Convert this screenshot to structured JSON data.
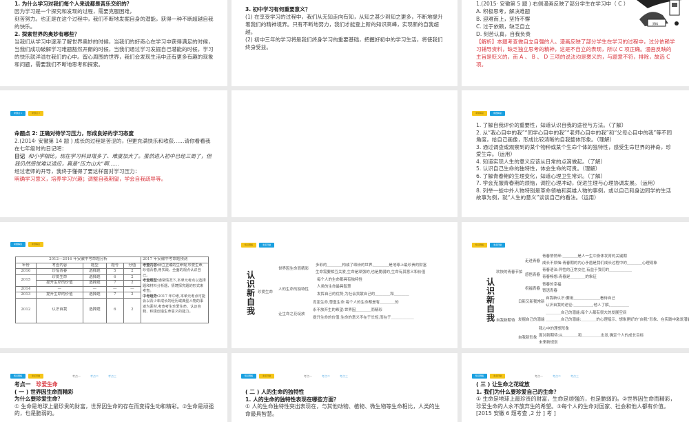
{
  "slides": {
    "s1": {
      "q1": "1. 为什么学习对我们每个人来说都是苦乐交织的？",
      "a1": "因为学习是一个探究和发现的过程，需要克服困难，",
      "a1b": "刻苦努力。也正是在这个过程中，我们不断地发掘自身的潜能，获得一种不断超越自我的快乐。",
      "q2": "2. 探索世界的奥妙有哪些？",
      "a2": "当我们从学习中逐渐了解世界奥妙的时候，当我们的好奇心在学习中获得满足的时候，当我们成功破解学习难题豁然开朗的时候，当我们通过学习发掘自己潜能的时候，学习的快乐就洋溢在我们的心中。留心周围的世界，我们会发现生活中还有更多有趣的现象和问题，需要我们不断地思考和探索。"
    },
    "s2": {
      "q3": "3. 初中学习有何重要意义？",
      "a1": "(1) 在享受学习的过程中，我们从无知走向有知，从知之甚少到知之更多，不断地提升着我们的精神境界。只有不断地努力，我们才能登上新的知识高峰，实现新的自我超越。",
      "a2": "(2) 初中三年的学习将是我们终身学习的重要基础，把握好初中的学习生活，将使我们终身受益。"
    },
    "s3": {
      "q": "1.(2015· 安徽第 5 题 ) 右侧漫画反映了部分学生在学习中（  C  ）",
      "opts": [
        "A. 积极思考，解决难题",
        "B. 迎难而上，坚持不懈",
        "C. 过于依赖，缺乏自立",
        "D. 刻苦认真，自我负责"
      ],
      "analysis": "【解析】本题考查做自立自强的人。漫画反映了部分学生在学习的过程中，过分依赖学习辅导资料，缺乏独立思考的精神，这是不自立的表现，所以 C 项正确。漫画反映的主旨是贬义的，而 A 、 B 、 D 三项的说法均是褒义的，与题意不符，排除，故选 C 项。",
      "cartoon_label": "资料"
    },
    "s4": {
      "badges": [
        "命题点 1",
        "命题点 2"
      ],
      "title": "命题点 2: 正确对待学习压力，形成良好的学习态度",
      "q": "2.(2014· 安徽第 14 题 ) 成长的过程是苦涩的，但更充满快乐和收获……请你看看我在七年级时的日记吧：",
      "diary_label": "日记",
      "diary": "和小学相比，现在学习科目增多了、难度加大了。虽然进入初中已经三周了，但我仍然感觉难以适应，真是“压力山大”啊……",
      "lead": "经过老师的开导，我终于懂得了要这样面对学习压力：",
      "answer": "明确学习意义，培养学习兴趣；调整自我期望，学会自我疏导等。"
    },
    "s6": {
      "badges": [
        "考纲解读",
        "命题解读"
      ],
      "items": [
        "1. 了解自我评价的重要性，知道认识自我的途径与方法。（了解）",
        "2. 从“我心目中的我”“同学心目中的我”“老师心目中的我”和“父母心目中的我”等不同角度，给自己画像，形成比较清晰的自我整体形象。（理解）",
        "3. 通过调查或观察到的某个物种或某个生命个体的独特性，感受生命世界的神奇，珍爱生命。（运用）",
        "4. 知道实现人生的意义应该从日常的点滴做起。（了解）",
        "5. 认识自己生命的独特性，体会生命的可贵。（理解）",
        "6. 了解青春期的生理变化，知道心理卫生常识。（了解）",
        "7. 学会克服青春期的烦恼，调控心理冲动，促进生理与心理协调发展。（运用）",
        "8. 列举一些中外人物特别是革命领袖和英雄人物的事例，或以自己和身边同学的生活故事为例，就“人生的意义”谈谈自己的看法。（运用）"
      ]
    },
    "s7": {
      "badges": [
        "考纲解读",
        "命题解读"
      ],
      "table_title": "2012—2016 年安徽中考命题分析",
      "pred_title": "2017 年安徽中考命题预测",
      "headers": [
        "年份",
        "考查内容",
        "题型",
        "题号",
        "分值"
      ],
      "rows": [
        [
          "2016",
          "珍惜青春",
          "选择题",
          "5",
          "2"
        ],
        [
          "2015",
          "珍爱生命",
          "选择题",
          "6",
          "2"
        ],
        [
          "",
          "提升生命的价值",
          "选择题",
          "7",
          "2"
        ],
        [
          "2014",
          "—",
          "—",
          "—",
          "—"
        ],
        [
          "2013",
          "提升生命的价值",
          "选择题",
          "7",
          "2"
        ],
        [
          "2012",
          "认识自我",
          "选择题",
          "6",
          "2"
        ]
      ],
      "pred": [
        {
          "k": "考查内容:",
          "v": "树立正确的生命观,珍爱生命,珍惜青春,用实践、全面的观点认识自己。"
        },
        {
          "k": "考查题型:",
          "v": "通常情况下,本单元考点以选择题和材料分析题、情境探究题的形式来考查。"
        },
        {
          "k": "中考趋势:",
          "v": "2017 年中考,本单元考点可能会以青少年成长的经历或典型人物的事迹为素材,考查考生珍爱生命、认识自我、积极创造生命意义的能力。"
        }
      ]
    },
    "s8": {
      "badges": [
        "知识网络",
        "考点扫描"
      ],
      "root": "认识新自我",
      "branch": "珍爱生命",
      "subs": [
        "世界因生命而精彩",
        "人的生命的独特性",
        "让生命之花绽放"
      ],
      "leaves": [
        "多彩的＿＿＿＿构成了缤纷的世界,＿＿＿＿是地球上最珍贵的财富",
        "生命需要相互关爱,生命是顽强的,也是脆弱的,生命有其意义和价值",
        "每个人的生命都具有独特性",
        "人类的生命最具智慧",
        "发挥自己的优势,为社会贡献自己的＿＿＿＿和＿＿＿＿",
        "肯定生命,尊重生命:每个人的生命都是有＿＿＿＿的",
        "永不放弃生的希望:世界因＿＿＿＿而精彩",
        "提升生命的价值:生命的意义不在于长短,而在于＿＿＿＿＿＿"
      ]
    },
    "s9": {
      "badges": [
        "知识网络",
        "考点扫描"
      ],
      "root": "认识新自我",
      "branches": [
        "欢快的青春节拍",
        "自我新期待"
      ],
      "subs": [
        "走进青春",
        "感悟青春",
        "祝福青春",
        "日新又新我常新",
        "发掘自己的潜能",
        "自我新形象"
      ],
      "leaves": [
        "青春悄悄来:＿＿＿＿是人一生中身体发育的关键期",
        "成长不烦恼:青春期的内心矛盾是我们成长过程中的＿＿＿＿心理现象",
        "青春语法:异性的正常交往,有益于我们的＿＿＿＿＿＿",
        "青春畅想:青春是＿＿＿＿的象征",
        "青春的幸福",
        "寄语青春",
        "自我新认识:要用＿＿＿＿＿＿＿看待自己",
        "认识自我的途径:＿＿＿＿＿,他人了解,＿＿＿＿＿",
        "＿＿＿＿自己的潜能:每个人都有很大的发展空间",
        "＿＿＿＿自己的潜能:＿＿＿＿的心理暗示、想象更好的“自我”形象、在实践中激发潜能",
        "我心中的理想形象",
        "面对新期待:从＿＿＿＿和＿＿＿＿＿出发,确定个人的成长目标",
        "未来新规划"
      ]
    },
    "s10": {
      "badges": [
        "知识网络",
        "考点扫描"
      ],
      "tabs": [
        "考点一",
        "考点二",
        "考点三"
      ],
      "h1": "考点一",
      "h1red": "珍爱生命",
      "h2": "( 一 ) 世界因生命而精彩",
      "h3": "为什么要珍爱生命？",
      "p": "① 生命是地球上最珍贵的财富，世界因生命的存在而变得生动和精彩。②生命是顽强的，也是脆弱的。"
    },
    "s11": {
      "badges": [
        "知识网络",
        "考点扫描"
      ],
      "tabs": [
        "考点一",
        "考点二",
        "考点三"
      ],
      "h2": "( 二 ) 人的生命的独特性",
      "h3": "1. 人的生命的独特性表现在哪些方面？",
      "p": "① 人的生命独特性突出表现在，与其他动物、植物、微生物等生命相比，人类的生命最具智慧。"
    },
    "s12": {
      "badges": [
        "知识网络",
        "考点扫描"
      ],
      "tabs": [
        "考点一",
        "考点二",
        "考点三"
      ],
      "h2": "( 三 ) 让生命之花绽放",
      "h3": "1. 我们为什么要珍爱自己的生命？",
      "p": "① 生命是地球上最珍贵的财富，生命是顽强的，也是脆弱的。②世界因生命而精彩，珍爱生命的人永不放弃生的希望。③每个人的生命对国家、社会和他人都有价值。[2015 安徽 6 题考查 ,2 分 ] 考 ]"
    }
  }
}
